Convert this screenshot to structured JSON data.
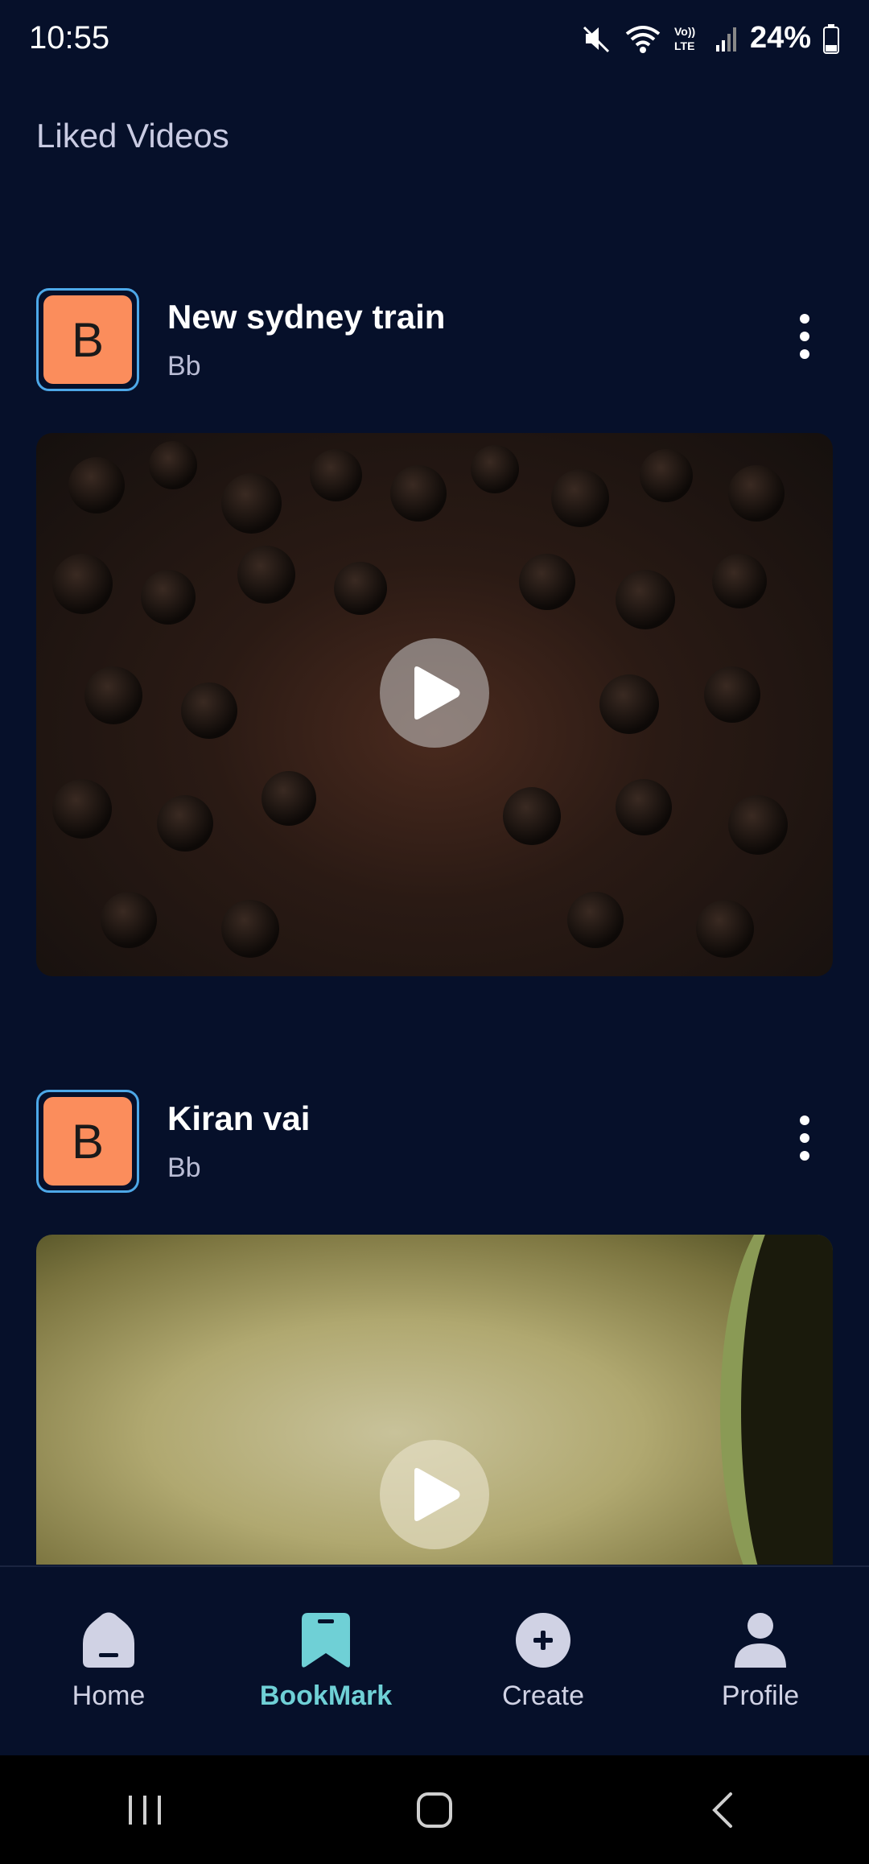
{
  "status_bar": {
    "time": "10:55",
    "battery": "24%"
  },
  "page": {
    "title": "Liked Videos"
  },
  "videos": [
    {
      "avatar_letter": "B",
      "title": "New sydney train",
      "subtitle": "Bb"
    },
    {
      "avatar_letter": "B",
      "title": "Kiran vai",
      "subtitle": "Bb"
    }
  ],
  "bottom_nav": {
    "items": [
      {
        "label": "Home",
        "icon": "home-icon",
        "active": false
      },
      {
        "label": "BookMark",
        "icon": "bookmark-icon",
        "active": true
      },
      {
        "label": "Create",
        "icon": "plus-circle-icon",
        "active": false
      },
      {
        "label": "Profile",
        "icon": "person-icon",
        "active": false
      }
    ]
  },
  "colors": {
    "background": "#06102a",
    "accent": "#6fd0d6",
    "avatar": "#fb8d5c",
    "avatar_border": "#4da8e8"
  }
}
